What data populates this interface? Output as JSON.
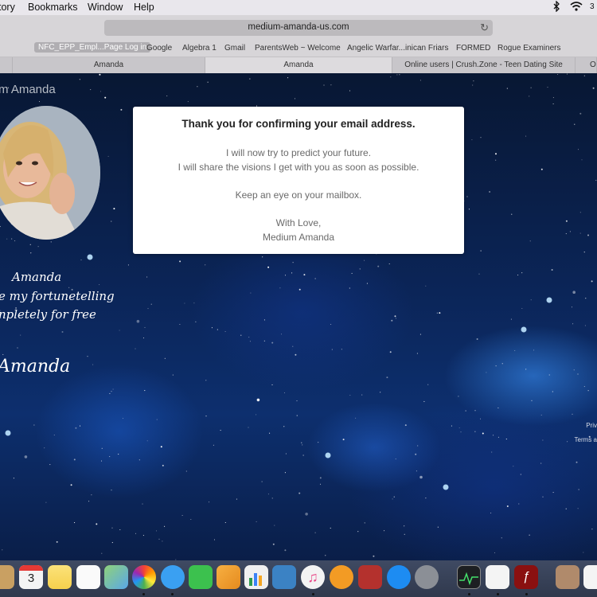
{
  "menubar": {
    "items": [
      "tory",
      "Bookmarks",
      "Window",
      "Help"
    ],
    "status_clock": "3"
  },
  "browser": {
    "url": "medium-amanda-us.com",
    "bookmarks": [
      "NFC_EPP_Empl...Page Log in",
      "Google",
      "Algebra 1",
      "Gmail",
      "ParentsWeb ~ Welcome",
      "Angelic Warfar...inican Friars",
      "FORMED",
      "Rogue Examiners"
    ],
    "tabs": [
      "Amanda",
      "Amanda",
      "Online users | Crush.Zone - Teen Dating Site",
      "O"
    ]
  },
  "page": {
    "site_title": "m Amanda",
    "script_lines": [
      "Amanda",
      "e my fortunetelling",
      "npletely for free"
    ],
    "signature": "Amanda",
    "footer_links": [
      "Priv",
      "Terms a"
    ]
  },
  "dialog": {
    "heading": "Thank you for confirming your email address.",
    "line1": "I will now try to predict your future.",
    "line2": "I will share the visions I get with you as soon as possible.",
    "line3": "Keep an eye on your mailbox.",
    "line4": "With Love,",
    "line5": "Medium Amanda"
  },
  "dock": {
    "calendar_day": "3",
    "icons": [
      "finder-icon",
      "calendar-icon",
      "notes-icon",
      "reminders-icon",
      "maps-icon",
      "photos-icon",
      "messages-icon",
      "facetime-icon",
      "pages-icon",
      "numbers-icon",
      "keynote-icon",
      "itunes-icon",
      "ibooks-icon",
      "dictionary-icon",
      "app-store-icon",
      "system-preferences-icon",
      "activity-monitor-icon",
      "textedit-icon",
      "flash-icon",
      "photo-thumbnail-icon",
      "document-icon"
    ]
  },
  "colors": {
    "dialog_bg": "#ffffff",
    "sky_dark": "#081733",
    "sky_mid": "#0d2f6e",
    "menubar_bg": "#e9e7ec",
    "dock_bg": "#30394d"
  }
}
